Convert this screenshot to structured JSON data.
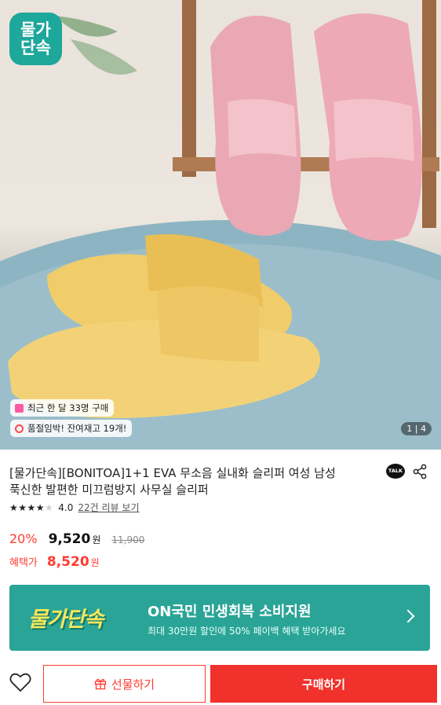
{
  "badge": {
    "line1": "물가",
    "line2": "단속"
  },
  "overlays": {
    "recent_purchase": "최근 한 달 33명 구매",
    "stock_alert": "품절임박! 잔여재고 19개!",
    "page_indicator": "1 | 4"
  },
  "product": {
    "title_line1": "[물가단속][BONITOA]1+1 EVA 무소음 실내화 슬리퍼 여성 남성",
    "title_line2": "푹신한 발편한 미끄럼방지 사무실 슬리퍼",
    "talk_label": "TALK",
    "rating_stars": 4,
    "rating_value": "4.0",
    "review_link": "22건 리뷰 보기"
  },
  "price": {
    "discount": "20%",
    "sale_price": "9,520",
    "won": "원",
    "original_price": "11,900",
    "benefit_label": "혜택가",
    "benefit_price": "8,520",
    "benefit_won": "원"
  },
  "banner": {
    "logo": "물가단속",
    "title": "ON국민 민생회복 소비지원",
    "subtitle": "최대 30만원 할인에 50% 페이백 혜택 받아가세요"
  },
  "actions": {
    "gift": "선물하기",
    "buy": "구매하기"
  },
  "colors": {
    "accent": "#f1312b",
    "badge": "#1ea79b",
    "banner": "#2aa497",
    "banner_logo": "#f6e85a"
  },
  "icons": [
    "share-icon",
    "talk-icon",
    "heart-icon",
    "gift-icon",
    "chevron-right-icon"
  ]
}
